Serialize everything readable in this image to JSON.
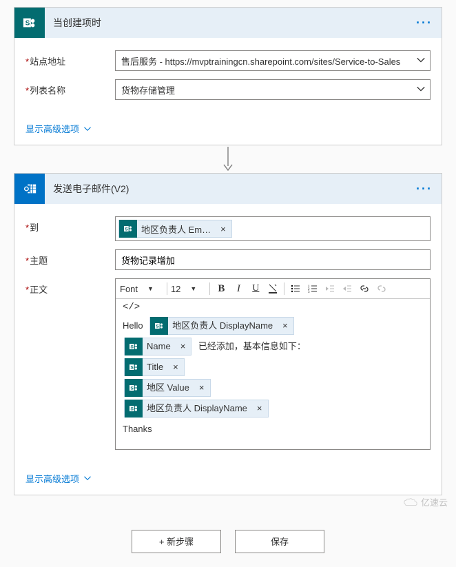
{
  "trigger": {
    "title": "当创建项时",
    "siteLabel": "站点地址",
    "siteValue": "售后服务 - https://mvptrainingcn.sharepoint.com/sites/Service-to-Sales",
    "listLabel": "列表名称",
    "listValue": "货物存储管理",
    "advanced": "显示高级选项"
  },
  "action": {
    "title": "发送电子邮件(V2)",
    "toLabel": "到",
    "toToken": "地区负责人 Em…",
    "subjectLabel": "主题",
    "subjectValue": "货物记录增加",
    "bodyLabel": "正文",
    "advanced": "显示高级选项",
    "toolbar": {
      "font": "Font",
      "size": "12"
    },
    "body": {
      "hello": "Hello",
      "t1": "地区负责人 DisplayName",
      "t2": "Name",
      "afterName": "已经添加，基本信息如下：",
      "t3": "Title",
      "t4": "地区 Value",
      "t5": "地区负责人 DisplayName",
      "thanks": "Thanks"
    }
  },
  "buttons": {
    "newStep": "+ 新步骤",
    "save": "保存"
  },
  "watermark": "亿速云"
}
